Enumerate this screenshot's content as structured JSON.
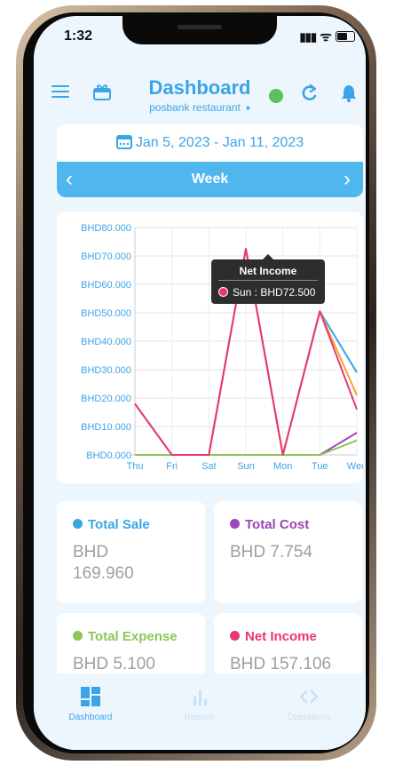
{
  "status_bar": {
    "time": "1:32",
    "signal": "▮▮▮",
    "wifi": "ᯤ"
  },
  "header": {
    "title": "Dashboard",
    "subtitle": "posbank restaurant",
    "caret": "▾",
    "refresh_glyph": "C"
  },
  "date_picker": {
    "range": "Jan 5, 2023 - Jan 11, 2023",
    "period": "Week",
    "prev": "‹",
    "next": "›"
  },
  "chart_data": {
    "type": "line",
    "categories": [
      "Thu",
      "Fri",
      "Sat",
      "Sun",
      "Mon",
      "Tue",
      "Wed"
    ],
    "ylim": [
      0,
      80
    ],
    "yticks": [
      "BHD0.000",
      "BHD10.000",
      "BHD20.000",
      "BHD30.000",
      "BHD40.000",
      "BHD50.000",
      "BHD60.000",
      "BHD70.000",
      "BHD80.000"
    ],
    "series": [
      {
        "key": "sale",
        "color": "#3aa5e6",
        "values": [
          18,
          0,
          0,
          72.5,
          0,
          50.5,
          29
        ]
      },
      {
        "key": "cost",
        "color": "#9c46b8",
        "values": [
          0,
          0,
          0,
          0,
          0,
          0,
          7.8
        ]
      },
      {
        "key": "expense",
        "color": "#8cc65a",
        "values": [
          0,
          0,
          0,
          0,
          0,
          0,
          5.1
        ]
      },
      {
        "key": "extra",
        "color": "#f6a53a",
        "values": [
          18,
          0,
          0,
          72.5,
          0,
          50.5,
          21
        ]
      },
      {
        "key": "net",
        "color": "#e8386d",
        "values": [
          18,
          0,
          0,
          72.5,
          0,
          50.5,
          16
        ]
      }
    ],
    "tooltip": {
      "title": "Net Income",
      "text": "Sun : BHD72.500",
      "color": "#e8386d"
    }
  },
  "stats": [
    {
      "label": "Total Sale",
      "value": "BHD 169.960",
      "color": "#3aa5e6"
    },
    {
      "label": "Total Cost",
      "value": "BHD 7.754",
      "color": "#9c46b8"
    },
    {
      "label": "Total Expense",
      "value": "BHD 5.100",
      "color": "#8cc65a"
    },
    {
      "label": "Net Income",
      "value": "BHD 157.106",
      "color": "#e8386d"
    }
  ],
  "tabs": [
    {
      "label": "Dashboard",
      "icon": "dashboard-icon",
      "active": true
    },
    {
      "label": "Reports",
      "icon": "bar-chart-icon",
      "active": false
    },
    {
      "label": "Operations",
      "icon": "code-brackets-icon",
      "active": false
    }
  ],
  "colors": {
    "accent": "#3aa5e6",
    "online": "#5cc05c",
    "inactive_tab": "#c7dff2"
  }
}
